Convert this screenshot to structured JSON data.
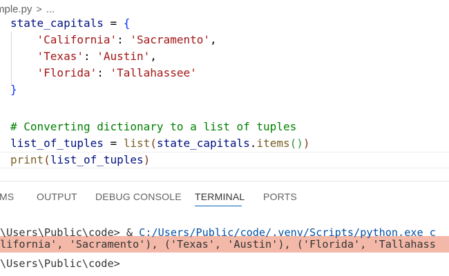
{
  "breadcrumb": {
    "file": "mple.py",
    "separator": ">",
    "more": "..."
  },
  "editor": {
    "lines": [
      {
        "var": "state_capitals",
        "op": " = ",
        "brace": "{"
      },
      {
        "key": "'California'",
        "colon": ": ",
        "value": "'Sacramento'",
        "comma": ","
      },
      {
        "key": "'Texas'",
        "colon": ": ",
        "value": "'Austin'",
        "comma": ","
      },
      {
        "key": "'Florida'",
        "colon": ": ",
        "value": "'Tallahassee'"
      },
      {
        "brace": "}"
      },
      {
        "comment": "# Converting dictionary to a list of tuples"
      },
      {
        "var": "list_of_tuples",
        "op": " = ",
        "fn": "list",
        "open": "(",
        "arg": "state_capitals",
        "dot": ".",
        "method": "items",
        "inner": "()",
        "close": ")"
      },
      {
        "fn": "print",
        "open": "(",
        "arg": "list_of_tuples",
        "close": ")"
      }
    ]
  },
  "panel": {
    "tabs": [
      {
        "label": "MS"
      },
      {
        "label": "OUTPUT"
      },
      {
        "label": "DEBUG CONSOLE"
      },
      {
        "label": "TERMINAL",
        "active": true
      },
      {
        "label": "PORTS"
      }
    ],
    "terminal": {
      "line1_prompt": "\\Users\\Public\\code> & ",
      "line1_path": "C:/Users/Public/code/.venv/Scripts/python.exe c",
      "line2_output": "lifornia', 'Sacramento'), ('Texas', 'Austin'), ('Florida', 'Tallahass",
      "line3_prompt": "\\Users\\Public\\code>"
    }
  },
  "colors": {
    "keyword_var": "#001080",
    "string": "#a31515",
    "comment": "#008000",
    "function": "#795e26",
    "active_tab_underline": "#005fb8",
    "terminal_highlight": "#f4b8a8"
  }
}
